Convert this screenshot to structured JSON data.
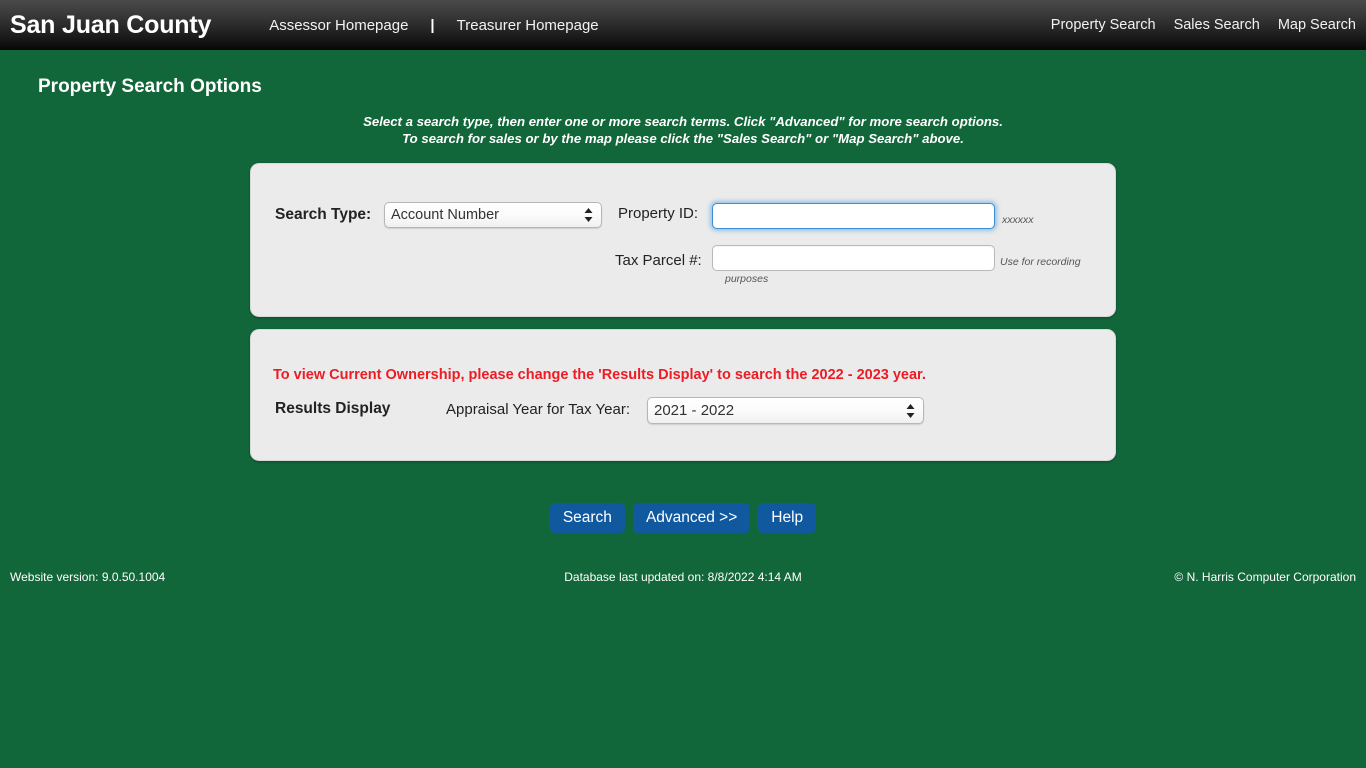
{
  "header": {
    "brand": "San Juan County",
    "nav_left": [
      {
        "label": "Assessor Homepage"
      },
      {
        "label": "Treasurer Homepage"
      }
    ],
    "separator": "|",
    "nav_right": [
      {
        "label": "Property Search"
      },
      {
        "label": "Sales Search"
      },
      {
        "label": "Map Search"
      }
    ]
  },
  "page": {
    "title": "Property Search Options",
    "instructions_line1": "Select a search type, then enter one or more search terms. Click \"Advanced\" for more search options.",
    "instructions_line2": "To search for sales or by the map please click the \"Sales Search\" or \"Map Search\" above."
  },
  "search_panel": {
    "search_type_label": "Search Type:",
    "search_type_value": "Account Number",
    "search_type_options": [
      "Account Number"
    ],
    "property_id_label": "Property ID:",
    "property_id_value": "",
    "property_id_hint": "xxxxxx",
    "tax_parcel_label": "Tax Parcel #:",
    "tax_parcel_value": "",
    "tax_parcel_hint_line1": "Use for recording",
    "tax_parcel_hint_line2": "purposes"
  },
  "results_panel": {
    "warning": "To view Current Ownership, please change the 'Results Display' to search the 2022 - 2023 year.",
    "results_display_label": "Results Display",
    "appraisal_year_label": "Appraisal Year for Tax Year:",
    "appraisal_year_value": "2021 - 2022",
    "appraisal_year_options": [
      "2021 - 2022"
    ]
  },
  "buttons": {
    "search": "Search",
    "advanced": "Advanced >>",
    "help": "Help"
  },
  "footer": {
    "website_version": "Website version: 9.0.50.1004",
    "database_updated": "Database last updated on: 8/8/2022 4:14 AM",
    "copyright": "© N. Harris Computer Corporation"
  },
  "colors": {
    "page_green": "#11663a",
    "panel_gray": "#ebebeb",
    "button_blue": "#10599f",
    "warning_red": "#ed1c24",
    "focus_blue": "#3f8dd4"
  }
}
